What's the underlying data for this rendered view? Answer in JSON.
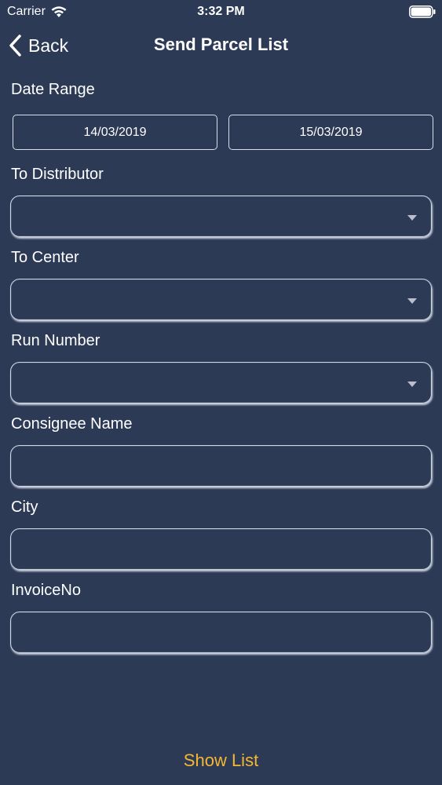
{
  "status_bar": {
    "carrier": "Carrier",
    "time": "3:32 PM"
  },
  "nav": {
    "back_label": "Back",
    "title": "Send Parcel List"
  },
  "form": {
    "date_range": {
      "label": "Date Range",
      "from": "14/03/2019",
      "to": "15/03/2019"
    },
    "to_distributor": {
      "label": "To Distributor",
      "value": ""
    },
    "to_center": {
      "label": "To Center",
      "value": ""
    },
    "run_number": {
      "label": "Run Number",
      "value": ""
    },
    "consignee_name": {
      "label": "Consignee Name",
      "value": ""
    },
    "city": {
      "label": "City",
      "value": ""
    },
    "invoice_no": {
      "label": "InvoiceNo",
      "value": ""
    }
  },
  "actions": {
    "show_list_label": "Show List"
  },
  "colors": {
    "background": "#2c3a56",
    "accent": "#f5b731",
    "text": "#ffffff"
  }
}
